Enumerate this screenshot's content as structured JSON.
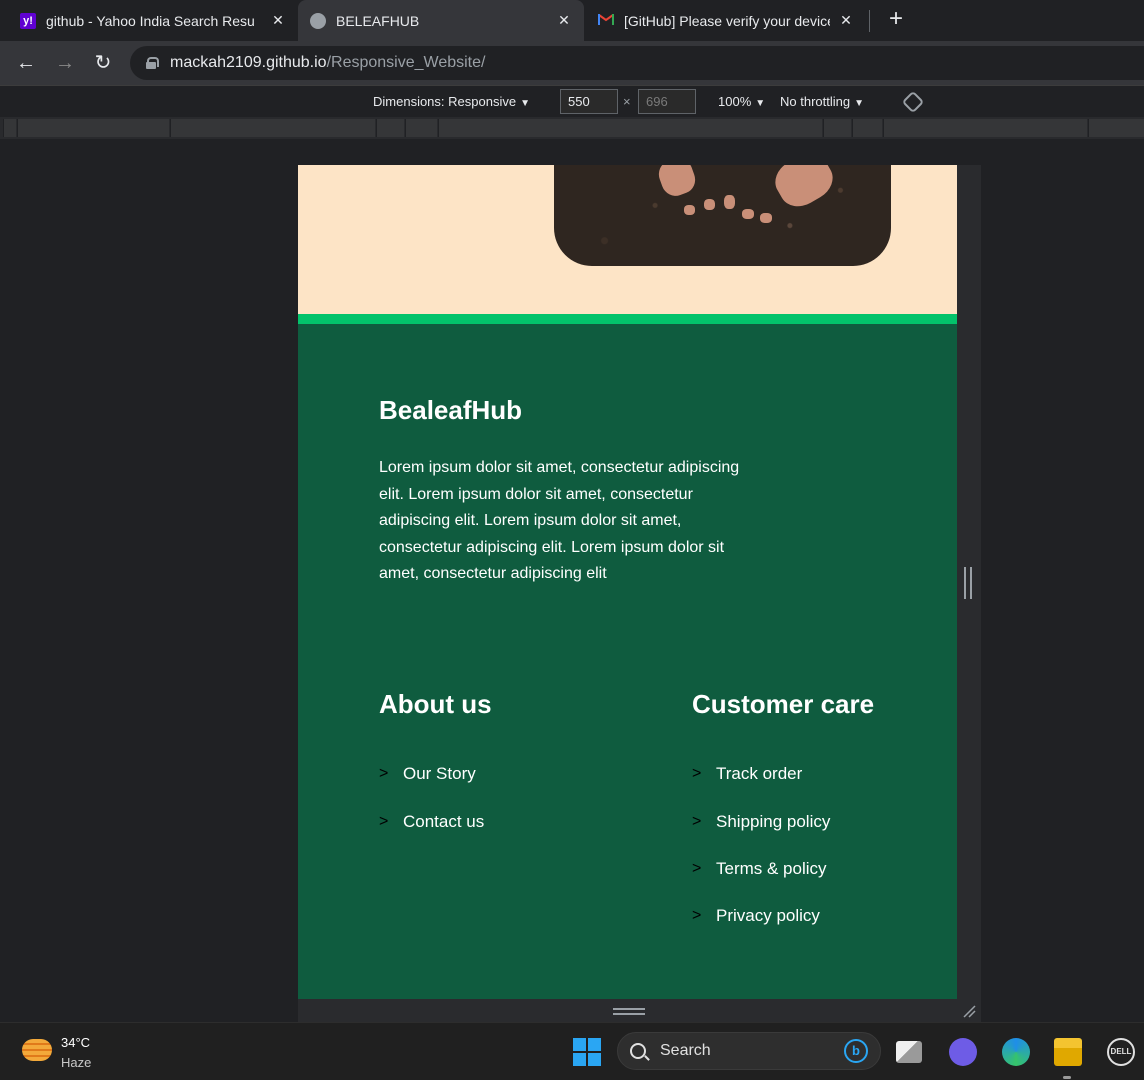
{
  "browser": {
    "tabs": [
      {
        "title": "github - Yahoo India Search Resu",
        "favicon": "yahoo-icon",
        "active": false
      },
      {
        "title": "BELEAFHUB",
        "favicon": "globe-icon",
        "active": true
      },
      {
        "title": "[GitHub] Please verify your device",
        "favicon": "gmail-icon",
        "active": false
      }
    ],
    "new_tab_label": "+",
    "url_host": "mackah2109.github.io",
    "url_path": "/Responsive_Website/"
  },
  "devtools": {
    "dimensions_label": "Dimensions: Responsive",
    "width_value": "550",
    "height_value": "696",
    "times": "×",
    "zoom": "100%",
    "throttling": "No throttling"
  },
  "page": {
    "brand": "BealeafHub",
    "description": "Lorem ipsum dolor sit amet, consectetur adipiscing elit. Lorem ipsum dolor sit amet, consectetur adipiscing elit. Lorem ipsum dolor sit amet, consectetur adipiscing elit. Lorem ipsum dolor sit amet, consectetur adipiscing elit",
    "about": {
      "title": "About us",
      "links": [
        "Our Story",
        "Contact us"
      ]
    },
    "care": {
      "title": "Customer care",
      "links": [
        "Track order",
        "Shipping policy",
        "Terms & policy",
        "Privacy policy"
      ]
    },
    "link_arrow": ">",
    "colors": {
      "hero_bg": "#fde4c6",
      "accent_line": "#03c36b",
      "footer_bg": "#0f5c3f"
    }
  },
  "taskbar": {
    "temperature": "34°C",
    "condition": "Haze",
    "search_label": "Search"
  }
}
